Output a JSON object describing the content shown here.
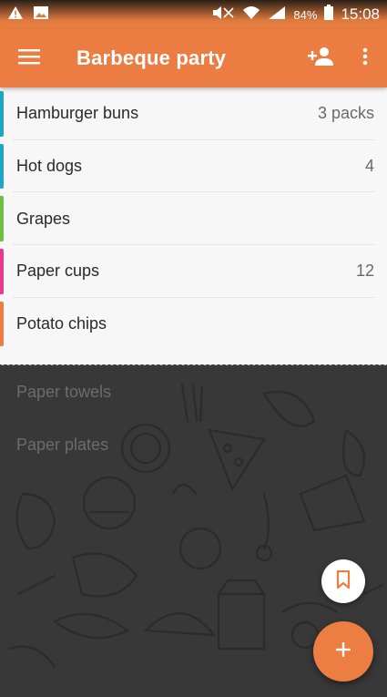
{
  "status_bar": {
    "battery": "84%",
    "time": "15:08",
    "left_icons": [
      "warning-icon",
      "image-icon"
    ],
    "right_icons": [
      "mute-icon",
      "wifi-icon",
      "signal-icon",
      "battery-icon"
    ]
  },
  "app_bar": {
    "title": "Barbeque party",
    "icons": [
      "menu-icon",
      "add-person-icon",
      "more-vert-icon"
    ]
  },
  "list": {
    "items": [
      {
        "name": "Hamburger buns",
        "qty": "3 packs",
        "color": "#1ea7c5"
      },
      {
        "name": "Hot dogs",
        "qty": "4",
        "color": "#1ea7c5"
      },
      {
        "name": "Grapes",
        "qty": "",
        "color": "#6fbe44"
      },
      {
        "name": "Paper cups",
        "qty": "12",
        "color": "#e93a8f"
      },
      {
        "name": "Potato chips",
        "qty": "",
        "color": "#eb7d42"
      }
    ]
  },
  "completed": {
    "items": [
      "Paper towels",
      "Paper plates"
    ]
  },
  "fabs": {
    "bookmark_icon": "bookmark-icon",
    "add_icon": "plus-icon"
  },
  "colors": {
    "accent": "#eb7d42",
    "list_background": "#f7f7f7",
    "dark_background": "#383838"
  }
}
